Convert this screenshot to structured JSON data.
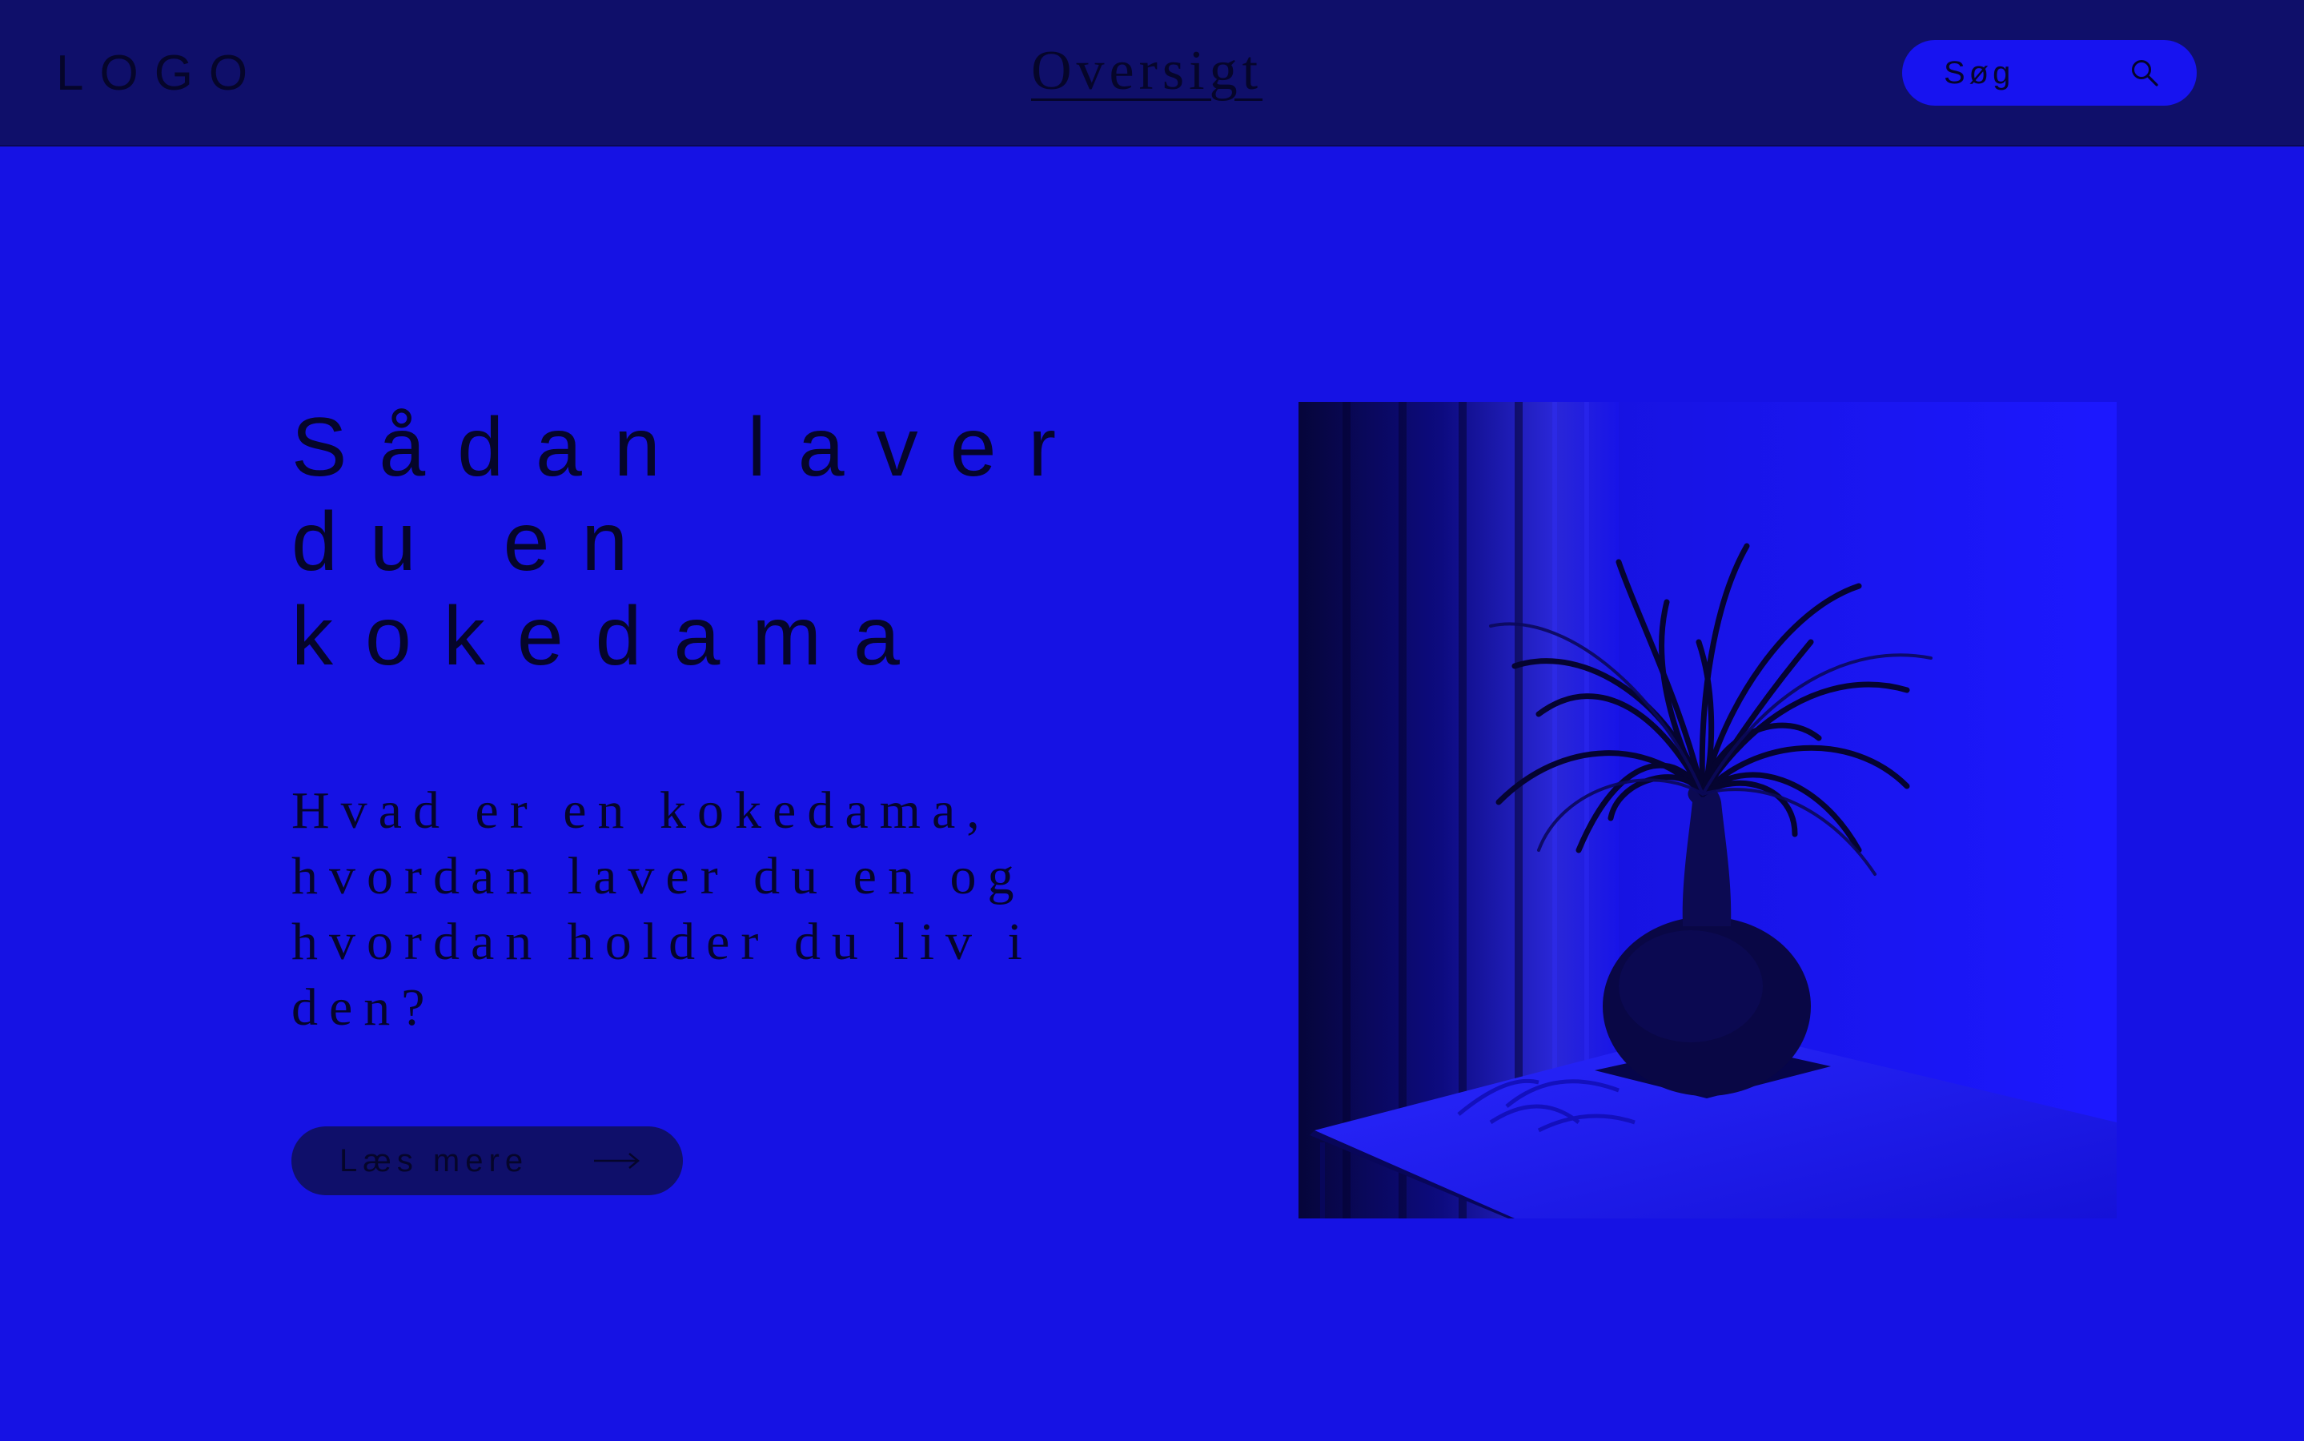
{
  "header": {
    "logo": "LOGO",
    "nav_link": "Oversigt",
    "search": {
      "placeholder": "Søg",
      "icon": "search-icon"
    }
  },
  "hero": {
    "headline": "Sådan laver du en kokedama",
    "subtitle": "Hvad er en kokedama, hvordan laver du en og hvordan holder du liv i den?",
    "button": {
      "label": "Læs mere",
      "icon": "arrow-right-icon"
    },
    "image": {
      "subject": "kokedama-plant-photo"
    }
  },
  "colors": {
    "background": "#1612e4",
    "header": "#0f0f6a",
    "search_pill": "#1713f0",
    "text": "#05052a"
  }
}
